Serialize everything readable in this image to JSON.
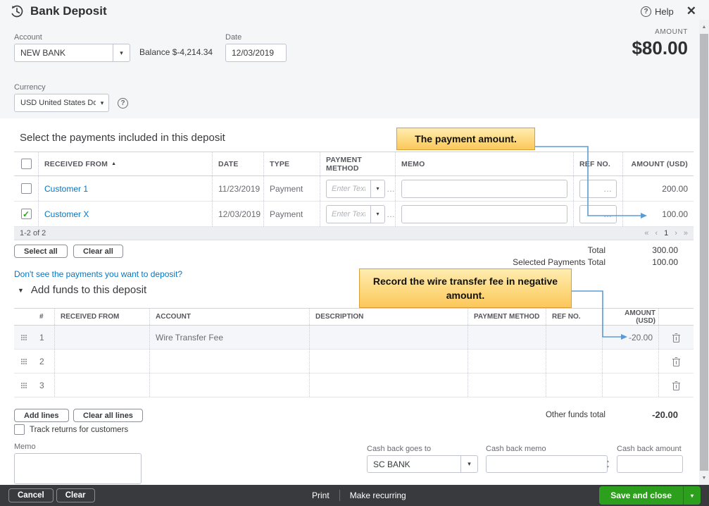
{
  "header": {
    "title": "Bank Deposit",
    "help_label": "Help"
  },
  "topform": {
    "account_label": "Account",
    "account_value": "NEW BANK",
    "balance_text": "Balance $-4,214.34",
    "date_label": "Date",
    "date_value": "12/03/2019",
    "amount_label": "AMOUNT",
    "amount_value": "$80.00",
    "currency_label": "Currency",
    "currency_value": "USD United States Dollar"
  },
  "payments": {
    "heading": "Select the payments included in this deposit",
    "columns": [
      "RECEIVED FROM",
      "DATE",
      "TYPE",
      "PAYMENT METHOD",
      "MEMO",
      "REF NO.",
      "AMOUNT (USD)"
    ],
    "pm_placeholder": "Enter Text",
    "rows": [
      {
        "checked": false,
        "received_from": "Customer 1",
        "date": "11/23/2019",
        "type": "Payment",
        "amount": "200.00"
      },
      {
        "checked": true,
        "received_from": "Customer X",
        "date": "12/03/2019",
        "type": "Payment",
        "amount": "100.00"
      }
    ],
    "pagination": {
      "range": "1-2 of 2",
      "first": "«",
      "prev": "‹",
      "page": "1",
      "next": "›",
      "last": "»"
    },
    "select_all": "Select all",
    "clear_all": "Clear all",
    "total_label": "Total",
    "total_value": "300.00",
    "selected_label": "Selected Payments Total",
    "selected_value": "100.00",
    "link": "Don't see the payments you want to deposit?"
  },
  "add_funds": {
    "heading": "Add funds to this deposit",
    "columns": [
      "#",
      "RECEIVED FROM",
      "ACCOUNT",
      "DESCRIPTION",
      "PAYMENT METHOD",
      "REF NO.",
      "AMOUNT (USD)"
    ],
    "rows": [
      {
        "num": "1",
        "account": "Wire Transfer Fee",
        "amount": "-20.00"
      },
      {
        "num": "2",
        "account": "",
        "amount": ""
      },
      {
        "num": "3",
        "account": "",
        "amount": ""
      }
    ],
    "add_lines": "Add lines",
    "clear_all_lines": "Clear all lines",
    "other_funds_label": "Other funds total",
    "other_funds_value": "-20.00",
    "track_returns_label": "Track returns for customers"
  },
  "bottom": {
    "memo_label": "Memo",
    "cash_back_goes_to_label": "Cash back goes to",
    "cash_back_goes_to_value": "SC BANK",
    "cash_back_memo_label": "Cash back memo",
    "cash_back_amount_label": "Cash back amount"
  },
  "footer": {
    "cancel": "Cancel",
    "clear": "Clear",
    "print": "Print",
    "make_recurring": "Make recurring",
    "save_and_close": "Save and close"
  },
  "annotations": [
    {
      "text": "The payment amount."
    },
    {
      "text": "Record the wire transfer fee in negative amount."
    }
  ],
  "icons": {
    "caret": "▾",
    "sort_asc": "▲",
    "collapse": "▼",
    "help": "?",
    "close": "✕",
    "check": "✓",
    "ellipsis": "…",
    "spin_up": "▴",
    "spin_down": "▾",
    "scroll_up": "▲",
    "scroll_down": "▼"
  },
  "colors": {
    "accent_green": "#2ca01c",
    "link_blue": "#0077c5",
    "footer_bg": "#393a3d",
    "annotation_fill": "#fdd97f",
    "annotation_border": "#dd9d33",
    "connector_blue": "#5b9bd5"
  }
}
